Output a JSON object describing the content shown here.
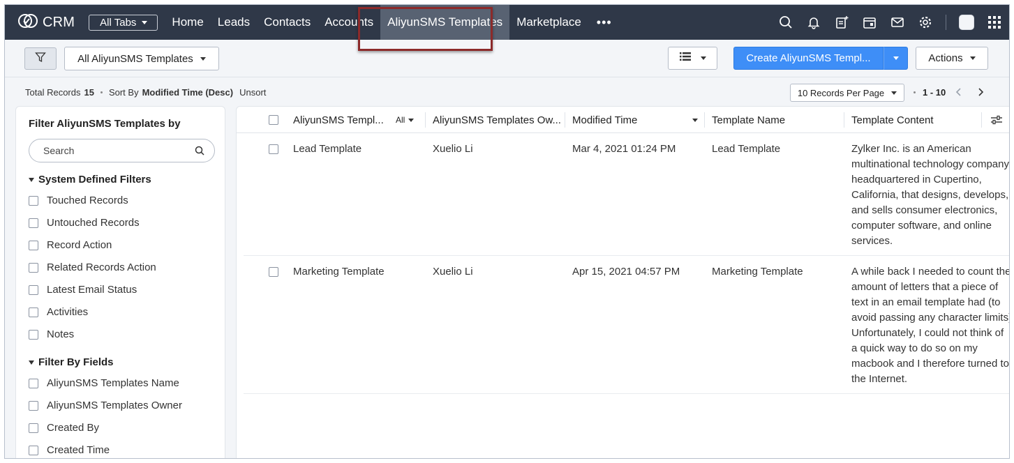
{
  "brand": {
    "name": "CRM"
  },
  "nav": {
    "all_tabs": "All Tabs",
    "tabs": [
      "Home",
      "Leads",
      "Contacts",
      "Accounts",
      "AliyunSMS Templates",
      "Marketplace"
    ],
    "more": "•••"
  },
  "toolbar": {
    "view": "All AliyunSMS Templates",
    "create": "Create AliyunSMS Templ...",
    "actions": "Actions"
  },
  "info": {
    "total_label": "Total Records",
    "total": "15",
    "sort_label": "Sort By",
    "sort_value": "Modified Time (Desc)",
    "unsort": "Unsort",
    "per_page": "10 Records Per Page",
    "range": "1 - 10"
  },
  "sidebar": {
    "title": "Filter AliyunSMS Templates by",
    "search_placeholder": "Search",
    "system_title": "System Defined Filters",
    "system_filters": [
      "Touched Records",
      "Untouched Records",
      "Record Action",
      "Related Records Action",
      "Latest Email Status",
      "Activities",
      "Notes"
    ],
    "fields_title": "Filter By Fields",
    "field_filters": [
      "AliyunSMS Templates Name",
      "AliyunSMS Templates Owner",
      "Created By",
      "Created Time"
    ]
  },
  "table": {
    "columns": [
      "AliyunSMS Templ...",
      "AliyunSMS Templates Ow...",
      "Modified Time",
      "Template Name",
      "Template Content"
    ],
    "all_label": "All",
    "rows": [
      {
        "name": "Lead Template",
        "owner": "Xuelio Li",
        "modified": "Mar 4, 2021 01:24 PM",
        "template_name": "Lead Template",
        "content": [
          "Zylker Inc. is an American",
          "multinational technology company",
          "headquartered in Cupertino,",
          "California, that designs, develops,",
          "and sells consumer electronics,",
          "computer software, and online",
          "services."
        ]
      },
      {
        "name": "Marketing Template",
        "owner": "Xuelio Li",
        "modified": "Apr 15, 2021 04:57 PM",
        "template_name": "Marketing Template",
        "content": [
          "A while back I needed to count the",
          "amount of letters that a piece of",
          "text in an email template had (to",
          "avoid passing any character limits).",
          "Unfortunately, I could not think of",
          "a quick way to do so on my",
          "macbook and I therefore turned to",
          "the Internet."
        ]
      }
    ]
  },
  "colors": {
    "nav_bg": "#2f3848",
    "active_tab": "#586272",
    "primary": "#3e8ef7",
    "highlight_box": "#8c2a2a"
  }
}
